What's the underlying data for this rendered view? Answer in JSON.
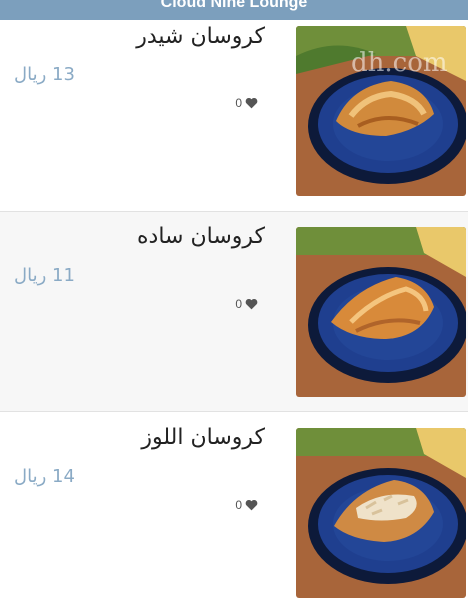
{
  "header": {
    "title": "Cloud Nine Lounge"
  },
  "watermark": "dh.com",
  "colors": {
    "header": "#7c9fbd",
    "price": "#8aaac5",
    "heart": "#555555"
  },
  "items": [
    {
      "name": "كروسان شيدر",
      "price": "13 ريال",
      "likes": "0"
    },
    {
      "name": "كروسان ساده",
      "price": "11 ريال",
      "likes": "0"
    },
    {
      "name": "كروسان اللوز",
      "price": "14 ريال",
      "likes": "0"
    }
  ]
}
